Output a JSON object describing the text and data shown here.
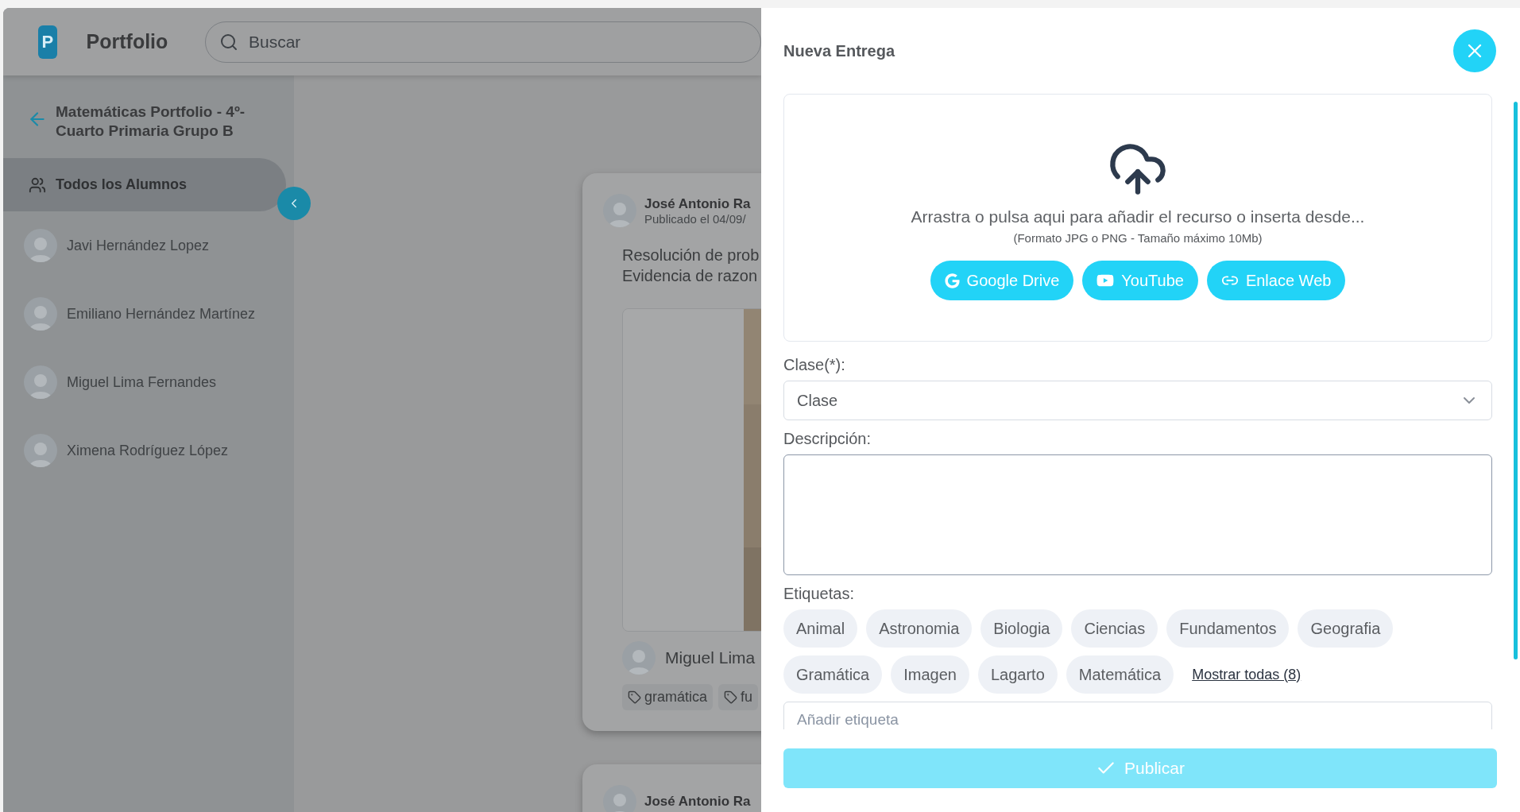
{
  "app": {
    "logo_letter": "P",
    "title": "Portfolio",
    "search": {
      "placeholder": "Buscar"
    }
  },
  "sidebar": {
    "back_title": "Matemáticas Portfolio - 4º- Cuarto Primaria Grupo B",
    "items": [
      {
        "label": "Todos los Alumnos",
        "kind": "group",
        "selected": true
      },
      {
        "label": "Javi Hernández Lopez",
        "kind": "student",
        "selected": false
      },
      {
        "label": "Emiliano Hernández Martínez",
        "kind": "student",
        "selected": false
      },
      {
        "label": "Miguel Lima Fernandes",
        "kind": "student",
        "selected": false
      },
      {
        "label": "Ximena Rodríguez López",
        "kind": "student",
        "selected": false
      }
    ]
  },
  "feed": {
    "posts": [
      {
        "author": "José Antonio Ra",
        "date": "Publicado el 04/09/",
        "text": [
          "Resolución de prob",
          "Evidencia de razon"
        ],
        "media": {
          "kind": "picture"
        },
        "student": "Miguel Lima",
        "tags": [
          "gramática",
          "fu"
        ]
      },
      {
        "author": "José Antonio Ra"
      }
    ]
  },
  "drawer": {
    "title": "Nueva Entrega",
    "upload": {
      "hint": "Arrastra o pulsa aqui para añadir el recurso o inserta desde...",
      "formats": "(Formato JPG o PNG - Tamaño máximo 10Mb)",
      "sources": [
        {
          "label": "Google Drive",
          "kind": "drive"
        },
        {
          "label": "YouTube",
          "kind": "youtube"
        },
        {
          "label": "Enlace Web",
          "kind": "link"
        }
      ]
    },
    "class_label": "Clase(*):",
    "class_value": "Clase",
    "description_label": "Descripción:",
    "tags_label": "Etiquetas:",
    "tags": [
      "Animal",
      "Astronomia",
      "Biologia",
      "Ciencias",
      "Fundamentos",
      "Geografia",
      "Gramática",
      "Imagen",
      "Lagarto",
      "Matemática"
    ],
    "show_all": "Mostrar todas (8)",
    "add_tag": {
      "placeholder": "Añadir etiqueta"
    },
    "publish": {
      "label": "Publicar",
      "disabled": true
    }
  }
}
